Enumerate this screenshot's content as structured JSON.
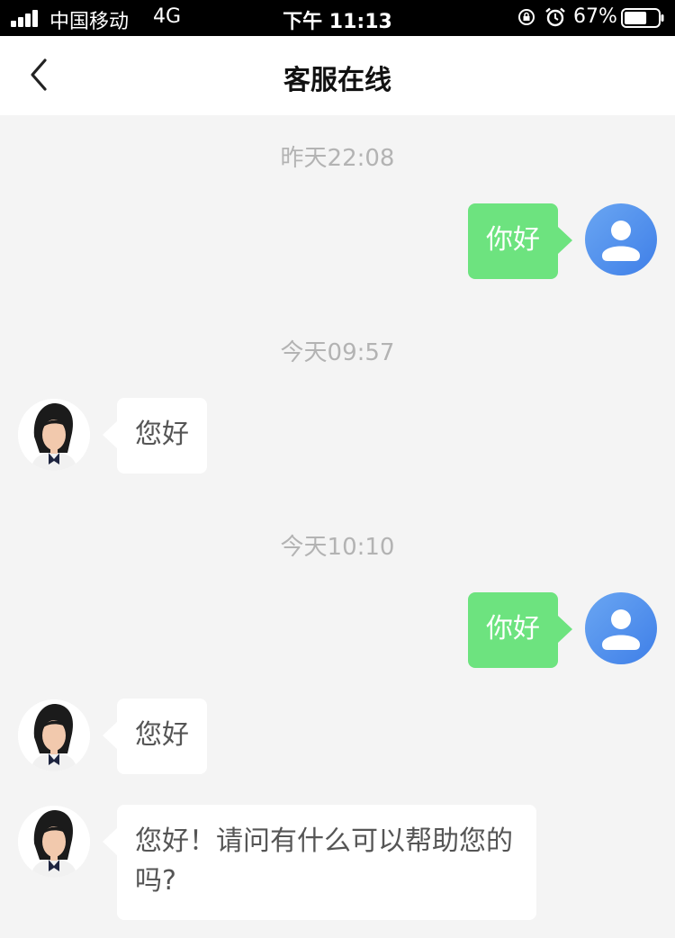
{
  "status_bar": {
    "carrier": "中国移动",
    "network": "4G",
    "time": "下午 11:13",
    "battery_percent": "67%",
    "battery_level": 0.67,
    "icons": [
      "signal-icon",
      "orientation-lock-icon",
      "alarm-icon",
      "battery-icon"
    ]
  },
  "nav": {
    "title": "客服在线",
    "back_icon": "chevron-left-icon"
  },
  "chat": {
    "timestamps": [
      "昨天22:08",
      "今天09:57",
      "今天10:10"
    ],
    "messages": [
      {
        "sender": "user",
        "text": "你好"
      },
      {
        "sender": "agent",
        "text": "您好"
      },
      {
        "sender": "user",
        "text": "你好"
      },
      {
        "sender": "agent",
        "text": "您好"
      },
      {
        "sender": "agent",
        "text": "您好！请问有什么可以帮助您的吗?"
      }
    ]
  },
  "colors": {
    "outgoing_bubble": "#6de37f",
    "incoming_bubble": "#ffffff",
    "background": "#f4f4f4",
    "user_avatar": "#4a8aec"
  }
}
